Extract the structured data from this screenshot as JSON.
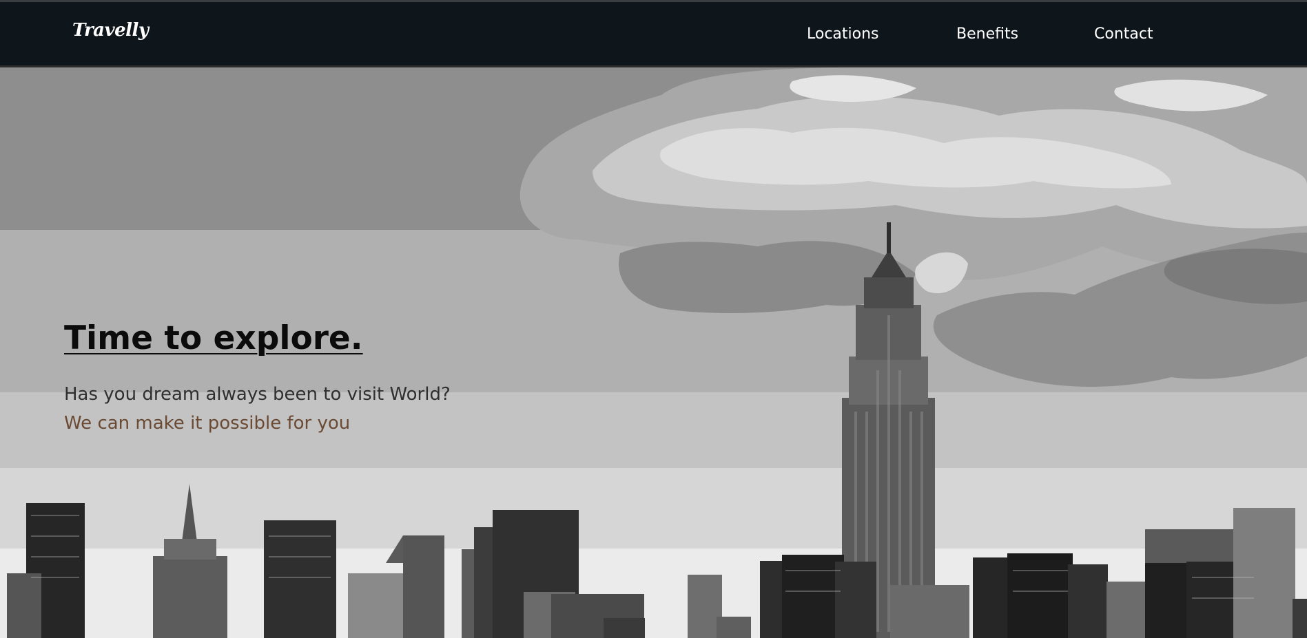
{
  "brand": {
    "logo_text": "Travelly"
  },
  "nav": {
    "items": [
      {
        "label": "Locations"
      },
      {
        "label": "Benefits"
      },
      {
        "label": "Contact"
      }
    ]
  },
  "hero": {
    "title": "Time to explore.",
    "subtitle": "Has you dream always been to visit World?",
    "tagline": "We can make it possible for you",
    "background_image": "city-skyline-grayscale",
    "colors": {
      "navbar": "#0e151b",
      "title": "#0b0b0b",
      "subtitle": "#2f2f2f",
      "tagline": "#6b4a34"
    }
  }
}
